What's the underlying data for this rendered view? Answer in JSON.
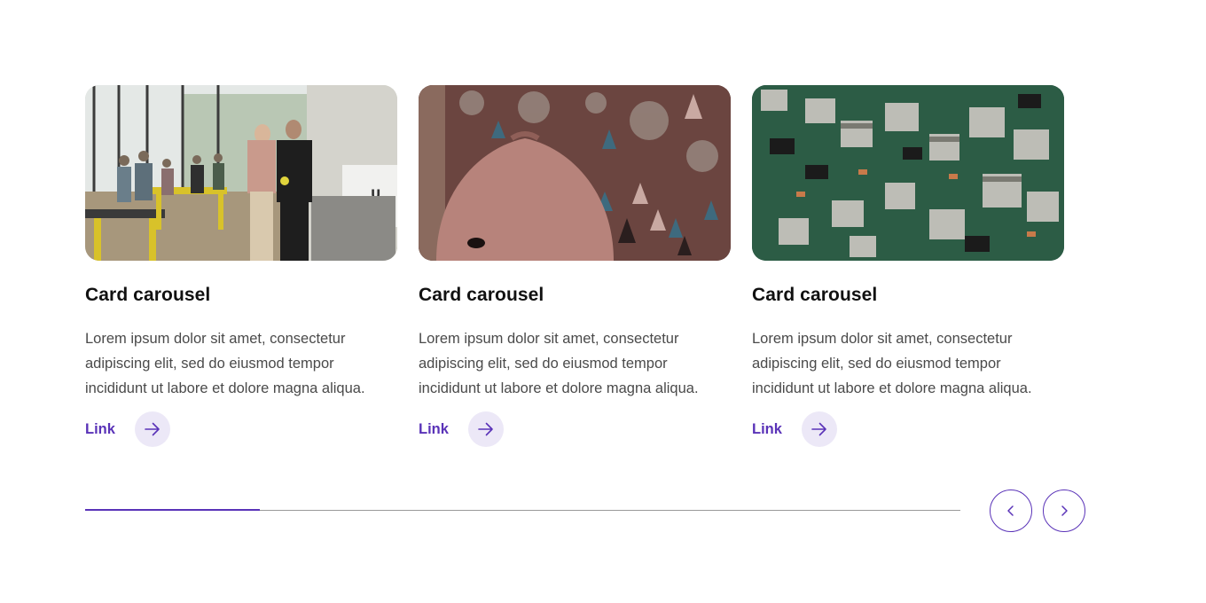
{
  "cards": [
    {
      "title": "Card carousel",
      "body": "Lorem ipsum dolor sit amet, consectetur adipiscing elit, sed do eiusmod tempor incididunt ut labore et dolore magna aliqua.",
      "link_label": "Link",
      "image": "makerspace-photo"
    },
    {
      "title": "Card carousel",
      "body": "Lorem ipsum dolor sit amet, consectetur adipiscing elit, sed do eiusmod tempor incididunt ut labore et dolore magna aliqua.",
      "link_label": "Link",
      "image": "pottery-tassels-photo"
    },
    {
      "title": "Card carousel",
      "body": "Lorem ipsum dolor sit amet, consectetur adipiscing elit, sed do eiusmod tempor incididunt ut labore et dolore magna aliqua.",
      "link_label": "Link",
      "image": "circuit-board-photo"
    }
  ],
  "progress": {
    "fraction": 0.2
  },
  "icons": {
    "link_arrow": "arrow-right-icon",
    "prev": "chevron-left-icon",
    "next": "chevron-right-icon"
  },
  "colors": {
    "accent": "#5a33b8",
    "link_bg": "#ece8f7",
    "title": "#111111",
    "body": "#4a4a4a",
    "track": "#9a9a9a"
  }
}
